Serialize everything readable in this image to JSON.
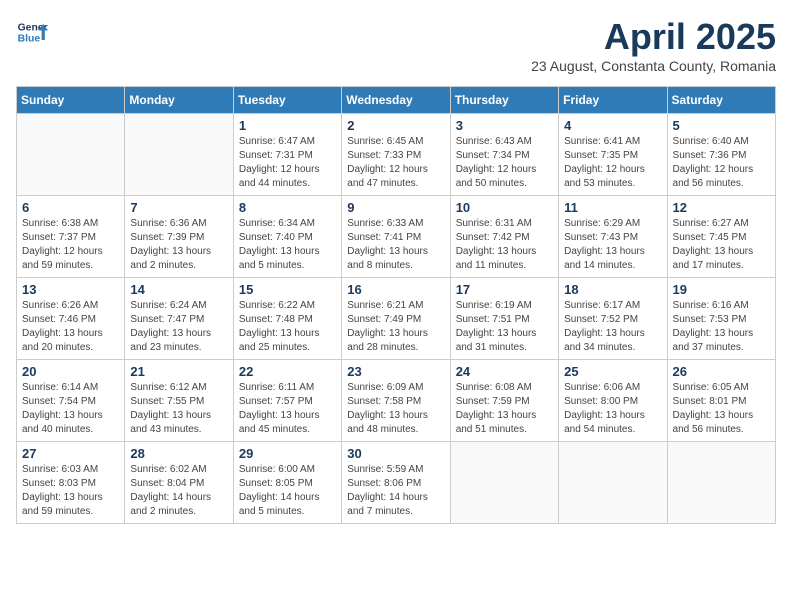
{
  "logo": {
    "line1": "General",
    "line2": "Blue"
  },
  "title": "April 2025",
  "subtitle": "23 August, Constanta County, Romania",
  "weekdays": [
    "Sunday",
    "Monday",
    "Tuesday",
    "Wednesday",
    "Thursday",
    "Friday",
    "Saturday"
  ],
  "weeks": [
    [
      {
        "day": "",
        "info": ""
      },
      {
        "day": "",
        "info": ""
      },
      {
        "day": "1",
        "info": "Sunrise: 6:47 AM\nSunset: 7:31 PM\nDaylight: 12 hours and 44 minutes."
      },
      {
        "day": "2",
        "info": "Sunrise: 6:45 AM\nSunset: 7:33 PM\nDaylight: 12 hours and 47 minutes."
      },
      {
        "day": "3",
        "info": "Sunrise: 6:43 AM\nSunset: 7:34 PM\nDaylight: 12 hours and 50 minutes."
      },
      {
        "day": "4",
        "info": "Sunrise: 6:41 AM\nSunset: 7:35 PM\nDaylight: 12 hours and 53 minutes."
      },
      {
        "day": "5",
        "info": "Sunrise: 6:40 AM\nSunset: 7:36 PM\nDaylight: 12 hours and 56 minutes."
      }
    ],
    [
      {
        "day": "6",
        "info": "Sunrise: 6:38 AM\nSunset: 7:37 PM\nDaylight: 12 hours and 59 minutes."
      },
      {
        "day": "7",
        "info": "Sunrise: 6:36 AM\nSunset: 7:39 PM\nDaylight: 13 hours and 2 minutes."
      },
      {
        "day": "8",
        "info": "Sunrise: 6:34 AM\nSunset: 7:40 PM\nDaylight: 13 hours and 5 minutes."
      },
      {
        "day": "9",
        "info": "Sunrise: 6:33 AM\nSunset: 7:41 PM\nDaylight: 13 hours and 8 minutes."
      },
      {
        "day": "10",
        "info": "Sunrise: 6:31 AM\nSunset: 7:42 PM\nDaylight: 13 hours and 11 minutes."
      },
      {
        "day": "11",
        "info": "Sunrise: 6:29 AM\nSunset: 7:43 PM\nDaylight: 13 hours and 14 minutes."
      },
      {
        "day": "12",
        "info": "Sunrise: 6:27 AM\nSunset: 7:45 PM\nDaylight: 13 hours and 17 minutes."
      }
    ],
    [
      {
        "day": "13",
        "info": "Sunrise: 6:26 AM\nSunset: 7:46 PM\nDaylight: 13 hours and 20 minutes."
      },
      {
        "day": "14",
        "info": "Sunrise: 6:24 AM\nSunset: 7:47 PM\nDaylight: 13 hours and 23 minutes."
      },
      {
        "day": "15",
        "info": "Sunrise: 6:22 AM\nSunset: 7:48 PM\nDaylight: 13 hours and 25 minutes."
      },
      {
        "day": "16",
        "info": "Sunrise: 6:21 AM\nSunset: 7:49 PM\nDaylight: 13 hours and 28 minutes."
      },
      {
        "day": "17",
        "info": "Sunrise: 6:19 AM\nSunset: 7:51 PM\nDaylight: 13 hours and 31 minutes."
      },
      {
        "day": "18",
        "info": "Sunrise: 6:17 AM\nSunset: 7:52 PM\nDaylight: 13 hours and 34 minutes."
      },
      {
        "day": "19",
        "info": "Sunrise: 6:16 AM\nSunset: 7:53 PM\nDaylight: 13 hours and 37 minutes."
      }
    ],
    [
      {
        "day": "20",
        "info": "Sunrise: 6:14 AM\nSunset: 7:54 PM\nDaylight: 13 hours and 40 minutes."
      },
      {
        "day": "21",
        "info": "Sunrise: 6:12 AM\nSunset: 7:55 PM\nDaylight: 13 hours and 43 minutes."
      },
      {
        "day": "22",
        "info": "Sunrise: 6:11 AM\nSunset: 7:57 PM\nDaylight: 13 hours and 45 minutes."
      },
      {
        "day": "23",
        "info": "Sunrise: 6:09 AM\nSunset: 7:58 PM\nDaylight: 13 hours and 48 minutes."
      },
      {
        "day": "24",
        "info": "Sunrise: 6:08 AM\nSunset: 7:59 PM\nDaylight: 13 hours and 51 minutes."
      },
      {
        "day": "25",
        "info": "Sunrise: 6:06 AM\nSunset: 8:00 PM\nDaylight: 13 hours and 54 minutes."
      },
      {
        "day": "26",
        "info": "Sunrise: 6:05 AM\nSunset: 8:01 PM\nDaylight: 13 hours and 56 minutes."
      }
    ],
    [
      {
        "day": "27",
        "info": "Sunrise: 6:03 AM\nSunset: 8:03 PM\nDaylight: 13 hours and 59 minutes."
      },
      {
        "day": "28",
        "info": "Sunrise: 6:02 AM\nSunset: 8:04 PM\nDaylight: 14 hours and 2 minutes."
      },
      {
        "day": "29",
        "info": "Sunrise: 6:00 AM\nSunset: 8:05 PM\nDaylight: 14 hours and 5 minutes."
      },
      {
        "day": "30",
        "info": "Sunrise: 5:59 AM\nSunset: 8:06 PM\nDaylight: 14 hours and 7 minutes."
      },
      {
        "day": "",
        "info": ""
      },
      {
        "day": "",
        "info": ""
      },
      {
        "day": "",
        "info": ""
      }
    ]
  ]
}
